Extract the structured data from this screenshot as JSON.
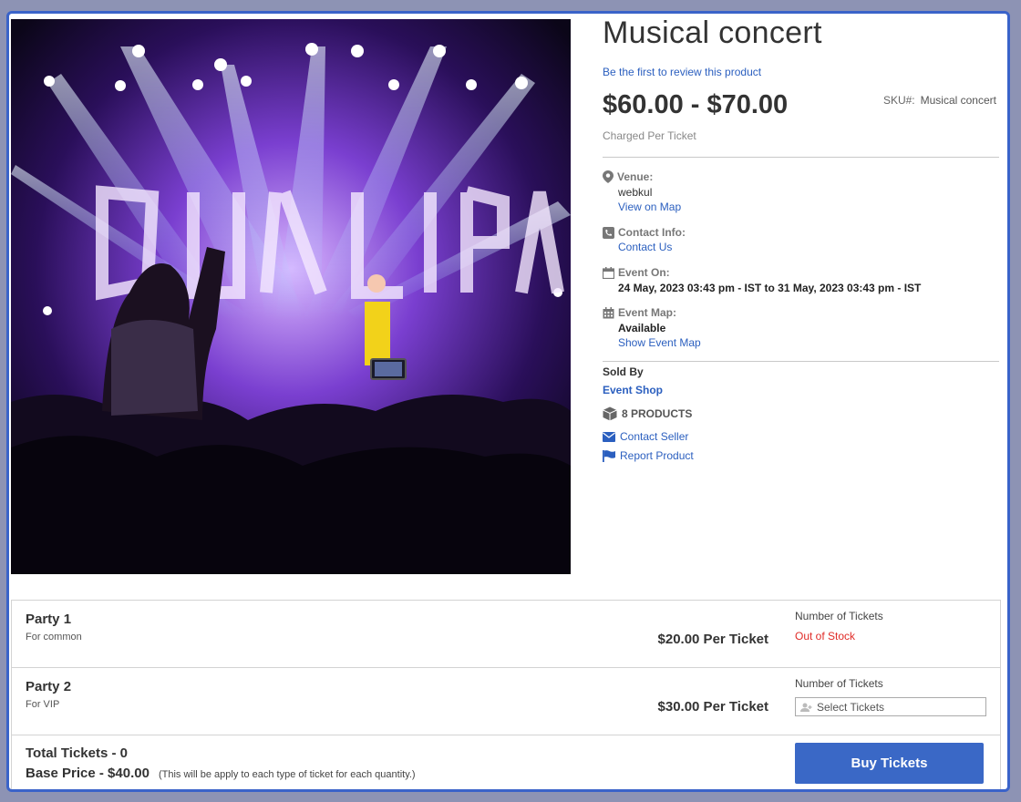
{
  "product": {
    "title": "Musical concert",
    "review_link": "Be the first to review this product",
    "price_range": "$60.00 - $70.00",
    "price_note": "Charged Per Ticket",
    "sku_label": "SKU#:",
    "sku_value": "Musical concert"
  },
  "details": {
    "venue_label": "Venue:",
    "venue_value": "webkul",
    "venue_link": "View on Map",
    "contact_label": "Contact Info:",
    "contact_link": "Contact Us",
    "event_on_label": "Event On:",
    "event_on_value": "24 May, 2023 03:43 pm - IST to 31 May, 2023 03:43 pm - IST",
    "event_map_label": "Event Map:",
    "event_map_value": "Available",
    "event_map_link": "Show Event Map"
  },
  "seller": {
    "sold_by_label": "Sold By",
    "shop_name": "Event Shop",
    "products_count": "8 PRODUCTS",
    "contact_seller": "Contact Seller",
    "report_product": "Report Product"
  },
  "tickets": [
    {
      "name": "Party 1",
      "desc": "For common",
      "price": "$20.00 Per Ticket",
      "qty_label": "Number of Tickets",
      "status": "Out of Stock"
    },
    {
      "name": "Party 2",
      "desc": "For VIP",
      "price": "$30.00 Per Ticket",
      "qty_label": "Number of Tickets",
      "placeholder": "Select Tickets"
    }
  ],
  "totals": {
    "total_tickets": "Total Tickets - 0",
    "base_price": "Base Price - $40.00",
    "base_note": "(This will be apply to each type of ticket for each quantity.)",
    "buy_label": "Buy Tickets"
  },
  "colors": {
    "link": "#2b5fbf",
    "out_of_stock": "#e02b27",
    "button": "#3a68c6",
    "frame_border": "#3a63c9"
  },
  "icons": [
    "map-pin-icon",
    "phone-icon",
    "calendar-icon",
    "calendar-grid-icon",
    "box-icon",
    "envelope-icon",
    "flag-icon",
    "user-icon"
  ]
}
